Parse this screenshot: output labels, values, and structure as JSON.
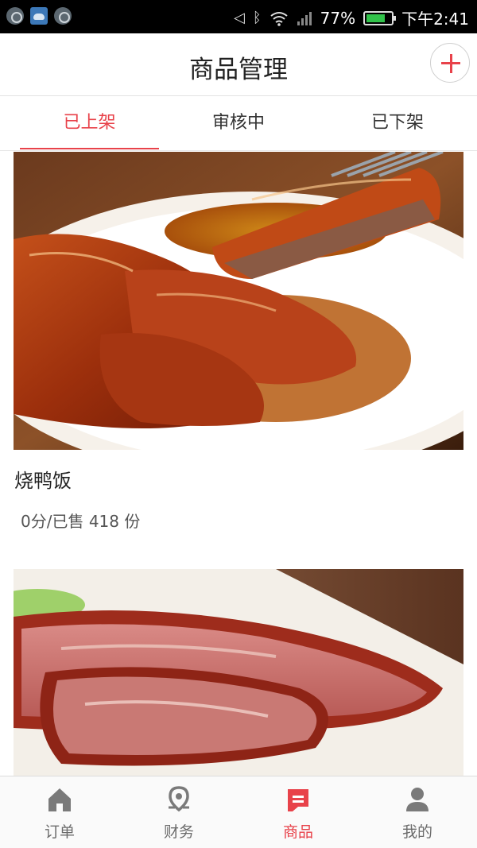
{
  "status_bar": {
    "battery": "77%",
    "battery_level": 0.77,
    "time": "下午2:41",
    "left_icons": [
      "lock-icon",
      "weather-icon",
      "lock-icon"
    ],
    "right_icons": [
      "mute-icon",
      "bluetooth-icon",
      "wifi-icon",
      "no-signal-icon",
      "battery-icon"
    ]
  },
  "header": {
    "title": "商品管理",
    "add_icon": "plus-icon",
    "accent_color": "#e8424a"
  },
  "tabs": [
    {
      "label": "已上架",
      "active": true
    },
    {
      "label": "审核中",
      "active": false
    },
    {
      "label": "已下架",
      "active": false
    }
  ],
  "products": [
    {
      "name": "烧鸭饭",
      "sales": "0分/已售 418 份",
      "image": "roast-duck-photo"
    },
    {
      "name": "",
      "sales": "",
      "image": "roast-pork-photo"
    }
  ],
  "bottom_nav": [
    {
      "label": "订单",
      "icon": "home-icon",
      "active": false
    },
    {
      "label": "财务",
      "icon": "location-pin-icon",
      "active": false
    },
    {
      "label": "商品",
      "icon": "goods-icon",
      "active": true
    },
    {
      "label": "我的",
      "icon": "user-icon",
      "active": false
    }
  ]
}
